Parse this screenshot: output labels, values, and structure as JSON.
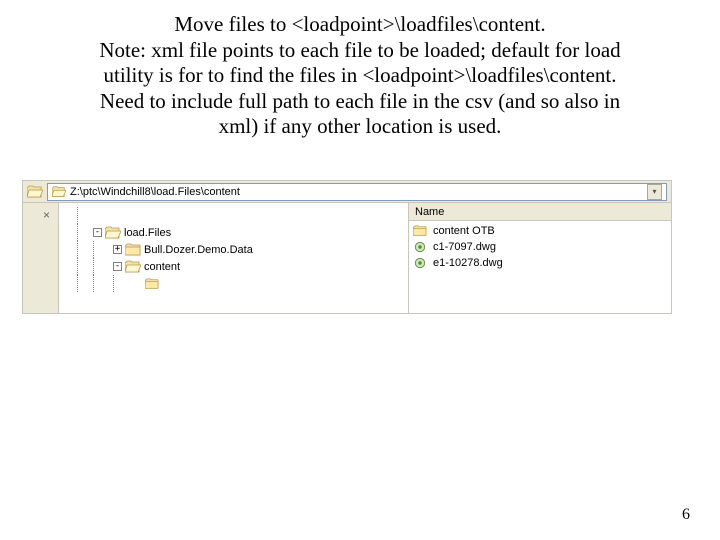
{
  "instructions": {
    "line1": "Move files to <loadpoint>\\loadfiles\\content.",
    "line2": "Note: xml file points to each file to be loaded; default for load",
    "line3": "utility is for to find the files in <loadpoint>\\loadfiles\\content.",
    "line4": "Need to include full path to each file in the csv (and so also in",
    "line5": "xml) if any other location is used."
  },
  "explorer": {
    "address_path": "Z:\\ptc\\Windchill8\\load.Files\\content",
    "close_glyph": "×",
    "dropdown_glyph": "▾",
    "tree": {
      "nodes": [
        {
          "indent": 34,
          "expander": "-",
          "icon": "folder-open",
          "label": "load.Files"
        },
        {
          "indent": 54,
          "expander": "+",
          "icon": "folder-closed",
          "label": "Bull.Dozer.Demo.Data"
        },
        {
          "indent": 54,
          "expander": "-",
          "icon": "folder-open",
          "label": "content"
        }
      ]
    },
    "filelist": {
      "column_header": "Name",
      "items": [
        {
          "icon": "folder-closed",
          "label": "content OTB"
        },
        {
          "icon": "dwg",
          "label": "c1-7097.dwg"
        },
        {
          "icon": "dwg",
          "label": "e1-10278.dwg"
        }
      ]
    }
  },
  "page_number": "6"
}
